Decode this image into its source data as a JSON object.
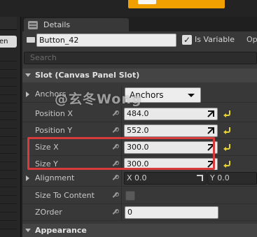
{
  "details_tab": {
    "label": "Details"
  },
  "name_row": {
    "widget_name": "Button_42",
    "is_variable_label": "Is Variable",
    "is_variable_checked": true,
    "trailing_label": "Op"
  },
  "left_panel": {
    "dropdown_label": "en"
  },
  "search": {
    "placeholder": "Search"
  },
  "slot_section": {
    "title": "Slot (Canvas Panel Slot)"
  },
  "properties": {
    "anchors": {
      "label": "Anchors",
      "value": "Anchors"
    },
    "position_x": {
      "label": "Position X",
      "value": "484.0"
    },
    "position_y": {
      "label": "Position Y",
      "value": "552.0"
    },
    "size_x": {
      "label": "Size X",
      "value": "300.0"
    },
    "size_y": {
      "label": "Size Y",
      "value": "300.0"
    },
    "alignment": {
      "label": "Alignment",
      "x": "X  0.0",
      "y": "Y  0.0"
    },
    "size_to_content": {
      "label": "Size To Content",
      "checked": false
    },
    "zorder": {
      "label": "ZOrder",
      "value": "0"
    }
  },
  "appearance_section": {
    "title": "Appearance"
  },
  "watermark": {
    "text": "@玄冬Wong"
  },
  "colors": {
    "accent_orange": "#f0a000",
    "highlight_red": "#d83b3b",
    "reset_yellow": "#e6d23a"
  }
}
